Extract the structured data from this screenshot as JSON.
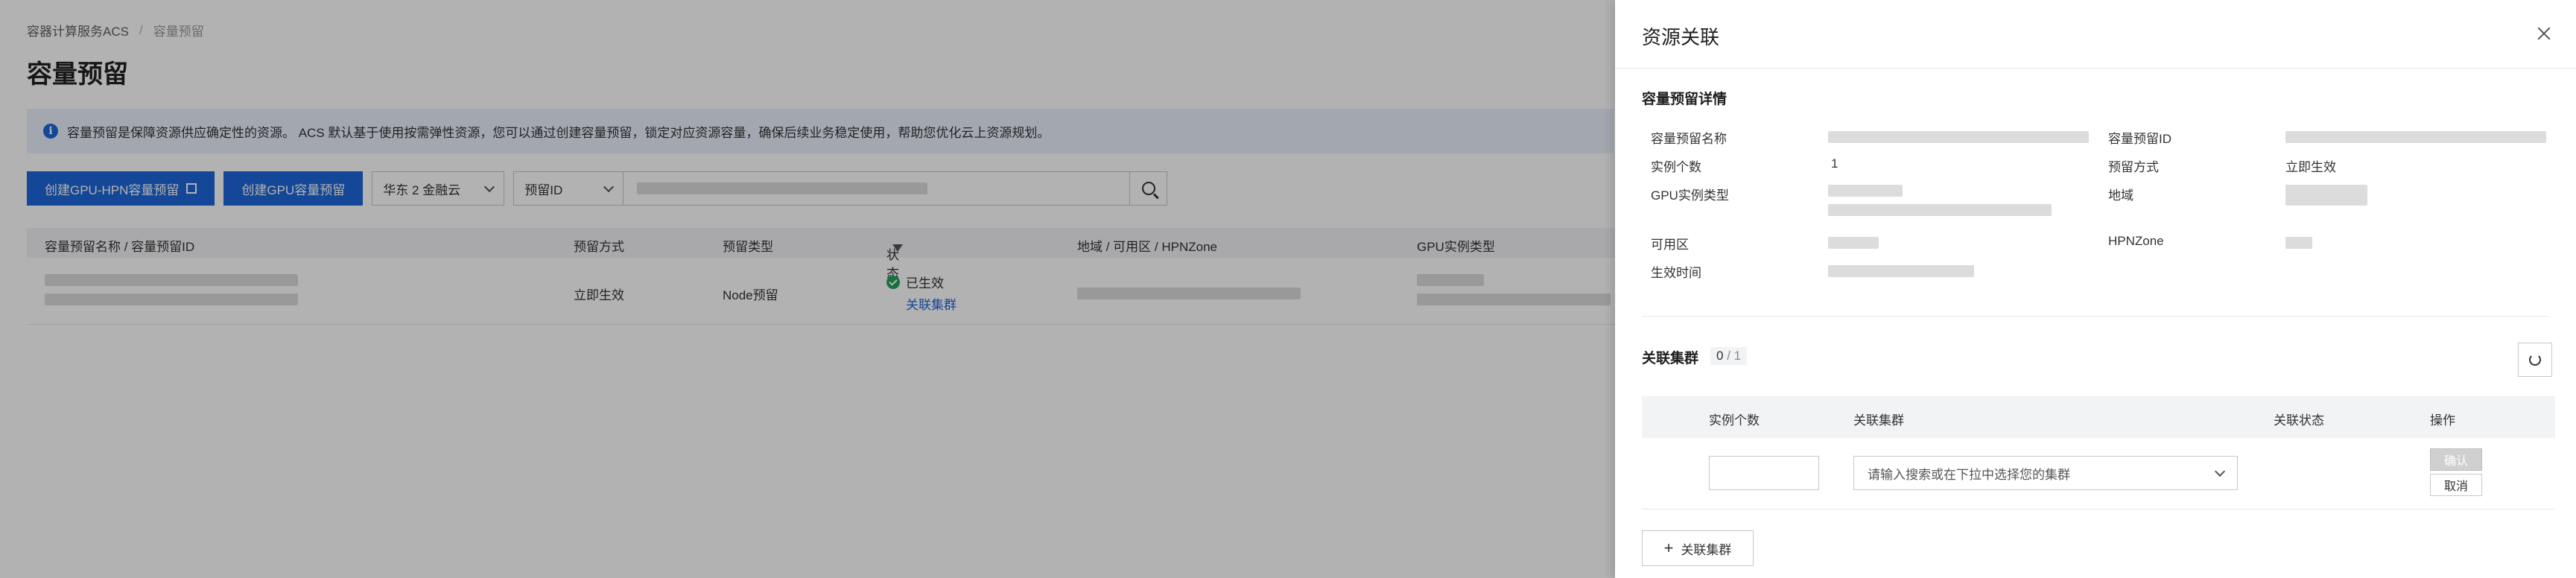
{
  "breadcrumb": {
    "root": "容器计算服务ACS",
    "current": "容量预留"
  },
  "page": {
    "title": "容量预留"
  },
  "banner": {
    "text": "容量预留是保障资源供应确定性的资源。 ACS 默认基于使用按需弹性资源，您可以通过创建容量预留，锁定对应资源容量，确保后续业务稳定使用，帮助您优化云上资源规划。"
  },
  "toolbar": {
    "create_hpn_label": "创建GPU-HPN容量预留",
    "create_gpu_label": "创建GPU容量预留",
    "region_select": "华东 2 金融云",
    "filter_select": "预留ID"
  },
  "table": {
    "headers": [
      "容量预留名称 / 容量预留ID",
      "预留方式",
      "预留类型",
      "状态",
      "地域 / 可用区 / HPNZone",
      "GPU实例类型"
    ],
    "row": {
      "mode": "立即生效",
      "type": "Node预留",
      "status": "已生效",
      "status_link": "关联集群"
    }
  },
  "drawer": {
    "title": "资源关联",
    "details_title": "容量预留详情",
    "fields": {
      "name_label": "容量预留名称",
      "id_label": "容量预留ID",
      "count_label": "实例个数",
      "count_value": "1",
      "mode_label": "预留方式",
      "mode_value": "立即生效",
      "gpu_type_label": "GPU实例类型",
      "region_label": "地域",
      "zone_label": "可用区",
      "hpnzone_label": "HPNZone",
      "effective_label": "生效时间"
    },
    "cluster_section": {
      "title": "关联集群",
      "count_current": "0",
      "count_sep": "/",
      "count_total": "1",
      "headers": [
        "实例个数",
        "关联集群",
        "关联状态",
        "操作"
      ],
      "select_placeholder": "请输入搜索或在下拉中选择您的集群",
      "confirm_label": "确认",
      "cancel_label": "取消",
      "add_label": "关联集群"
    }
  },
  "colors": {
    "primary": "#1e66d8",
    "success": "#23a35a"
  }
}
